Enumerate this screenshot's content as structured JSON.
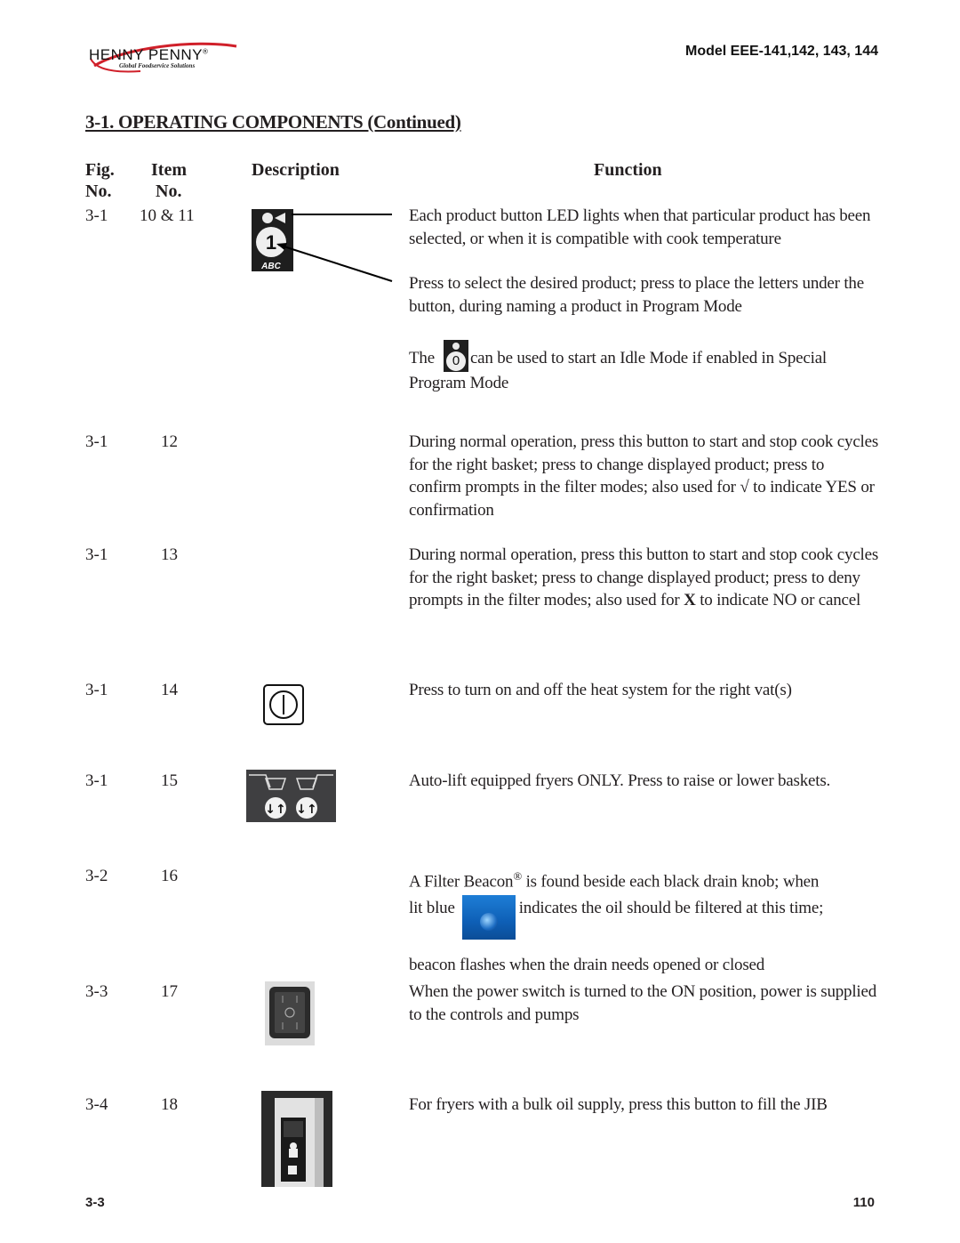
{
  "header": {
    "brand_name": "HENNY PENNY",
    "brand_registered": "®",
    "brand_tagline": "Global Foodservice Solutions",
    "model": "Model EEE-141,142, 143, 144"
  },
  "section_title": "3-1. OPERATING COMPONENTS (Continued)",
  "table": {
    "columns": {
      "fig_line1": "Fig.",
      "fig_line2": "No.",
      "item_line1": "Item",
      "item_line2": "No.",
      "description": "Description",
      "function": "Function"
    },
    "rows": [
      {
        "fig": "3-1",
        "item": "10 & 11",
        "icon": "product-button-icon",
        "icon_label": "1",
        "icon_sublabel": "ABC",
        "function": [
          "Each product button LED lights when that particular product has been selected, or when it is compatible with cook temperature",
          "Press to select the desired product; press to place the letters under the button, during naming a  product in Program Mode"
        ],
        "idle_note": {
          "prefix": "The",
          "button_label": "0",
          "suffix": "can be used to start an Idle Mode if enabled in Special Program Mode"
        }
      },
      {
        "fig": "3-1",
        "item": "12",
        "function": "During normal operation, press this button to start and stop cook cycles for the right basket; press to change displayed product; press to confirm prompts in the filter modes; also used for",
        "symbol": "√",
        "function_end": "to indicate YES or confirmation"
      },
      {
        "fig": "3-1",
        "item": "13",
        "function": "During normal operation, press this button to start and stop cook cycles for the right basket; press to change displayed product;   press to deny prompts in the filter modes; also used for",
        "symbol": "X",
        "function_end": "to indicate NO or cancel"
      },
      {
        "fig": "3-1",
        "item": "14",
        "icon": "power-button-icon",
        "function": "Press to turn on and off the heat system for the right vat(s)"
      },
      {
        "fig": "3-1",
        "item": "15",
        "icon": "basket-lift-icon",
        "function": "Auto-lift equipped fryers ONLY.  Press to raise or lower baskets."
      },
      {
        "fig": "3-2",
        "item": "16",
        "icon": "filter-beacon-icon",
        "function_a": "A Filter Beacon",
        "registered": "®",
        "function_b": "is found beside each black drain knob; when",
        "function_c": "lit blue",
        "function_d": "indicates the oil should be filtered at this time;",
        "function_e": "beacon flashes when the drain needs opened or closed"
      },
      {
        "fig": "3-3",
        "item": "17",
        "icon": "power-switch-icon",
        "function": "When the power switch is turned to the ON position, power is supplied to the controls and pumps"
      },
      {
        "fig": "3-4",
        "item": "18",
        "icon": "bulk-oil-fill-button-icon",
        "function": "For fryers with a bulk oil supply, press this button to fill the JIB"
      }
    ]
  },
  "footer": {
    "section_page": "3-3",
    "page_number": "110"
  }
}
